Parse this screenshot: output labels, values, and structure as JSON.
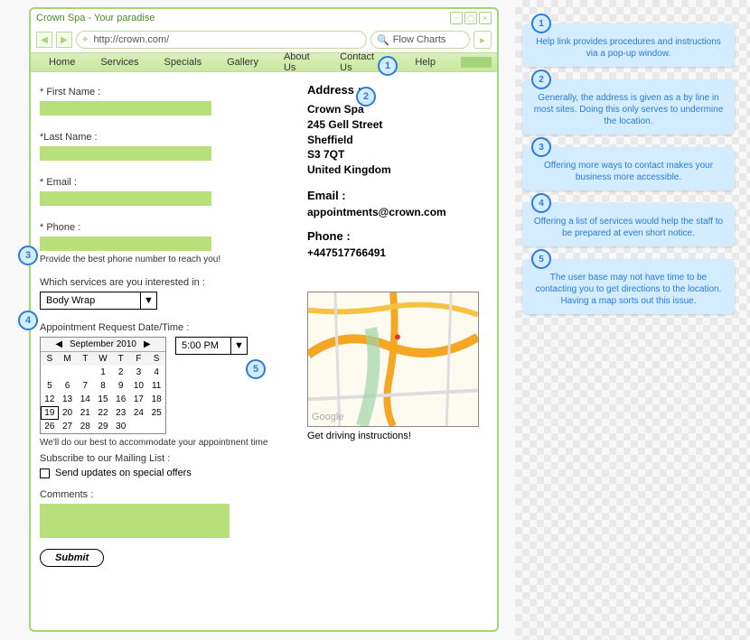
{
  "window": {
    "title": "Crown Spa - Your paradise",
    "url": "http://crown.com/",
    "search_placeholder": "Flow Charts"
  },
  "nav": [
    "Home",
    "Services",
    "Specials",
    "Gallery",
    "About Us",
    "Contact Us",
    "Help"
  ],
  "form": {
    "first_name_label": "* First Name :",
    "last_name_label": "*Last Name :",
    "email_label": "* Email :",
    "phone_label": "* Phone :",
    "phone_hint": "Provide the best phone number to reach you!",
    "services_label": "Which services are you interested in :",
    "services_value": "Body Wrap",
    "appt_label": "Appointment Request Date/Time :",
    "appt_time_value": "5:00 PM",
    "appt_hint": "We'll do our best to accommodate your appointment time",
    "mailing_label": "Subscribe to our Mailing List :",
    "mailing_opt": "Send updates on special offers",
    "comments_label": "Comments :",
    "submit_label": "Submit"
  },
  "calendar": {
    "month_label": "September 2010",
    "day_headers": [
      "S",
      "M",
      "T",
      "W",
      "T",
      "F",
      "S"
    ],
    "days": [
      "",
      "",
      "",
      "1",
      "2",
      "3",
      "4",
      "5",
      "6",
      "7",
      "8",
      "9",
      "10",
      "11",
      "12",
      "13",
      "14",
      "15",
      "16",
      "17",
      "18",
      "19",
      "20",
      "21",
      "22",
      "23",
      "24",
      "25",
      "26",
      "27",
      "28",
      "29",
      "30",
      "",
      ""
    ],
    "selected": "19"
  },
  "contact": {
    "address_label": "Address :",
    "lines": [
      "Crown Spa",
      "245 Gell Street",
      "Sheffield",
      "S3 7QT",
      "United Kingdom"
    ],
    "email_label": "Email :",
    "email_value": "appointments@crown.com",
    "phone_label": "Phone :",
    "phone_value": "+447517766491",
    "map_caption": "Get driving instructions!",
    "map_brand": "Google"
  },
  "annotations": [
    {
      "num": "1",
      "text": "Help link provides procedures and instructions via a pop-up window."
    },
    {
      "num": "2",
      "text": "Generally, the address is given as a by line in most sites. Doing this only serves to undermine the location."
    },
    {
      "num": "3",
      "text": "Offering more ways to contact makes your business more accessible."
    },
    {
      "num": "4",
      "text": "Offering a list of services would help the staff to be prepared at even short notice."
    },
    {
      "num": "5",
      "text": "The user base may not have time to be contacting you to get directions to the location. Having a map sorts out this issue."
    }
  ]
}
